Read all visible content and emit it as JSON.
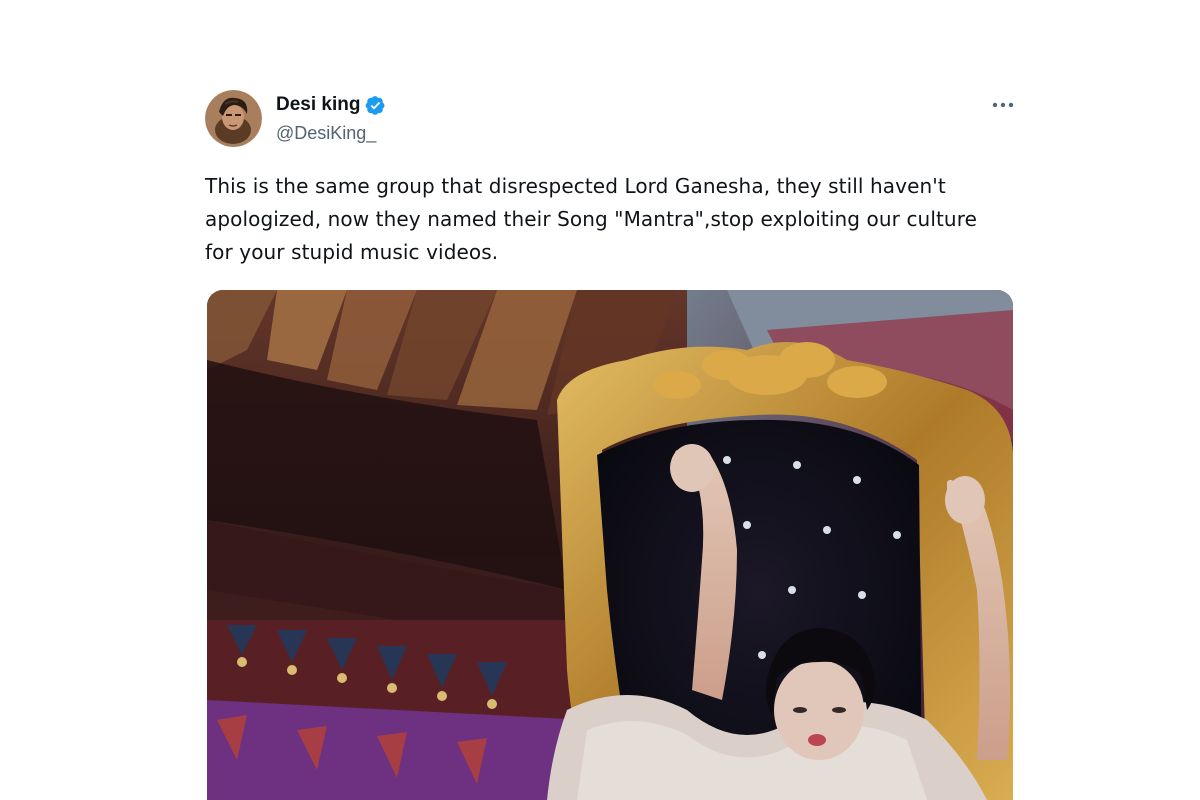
{
  "tweet": {
    "author": {
      "display_name": "Desi king",
      "handle": "@DesiKing_",
      "verified": true,
      "avatar_icon": "cartoon-avatar-icon"
    },
    "text": "This is the same group that disrespected Lord Ganesha, they still haven't apologized, now they named their Song \"Mantra\",stop exploiting our culture for your stupid music videos.",
    "more_icon": "more-options-icon",
    "media": {
      "kind": "image",
      "icon": "music-video-still-image"
    }
  },
  "colors": {
    "text_primary": "#0f1419",
    "text_secondary": "#536471",
    "verified_blue": "#1d9bf0"
  }
}
